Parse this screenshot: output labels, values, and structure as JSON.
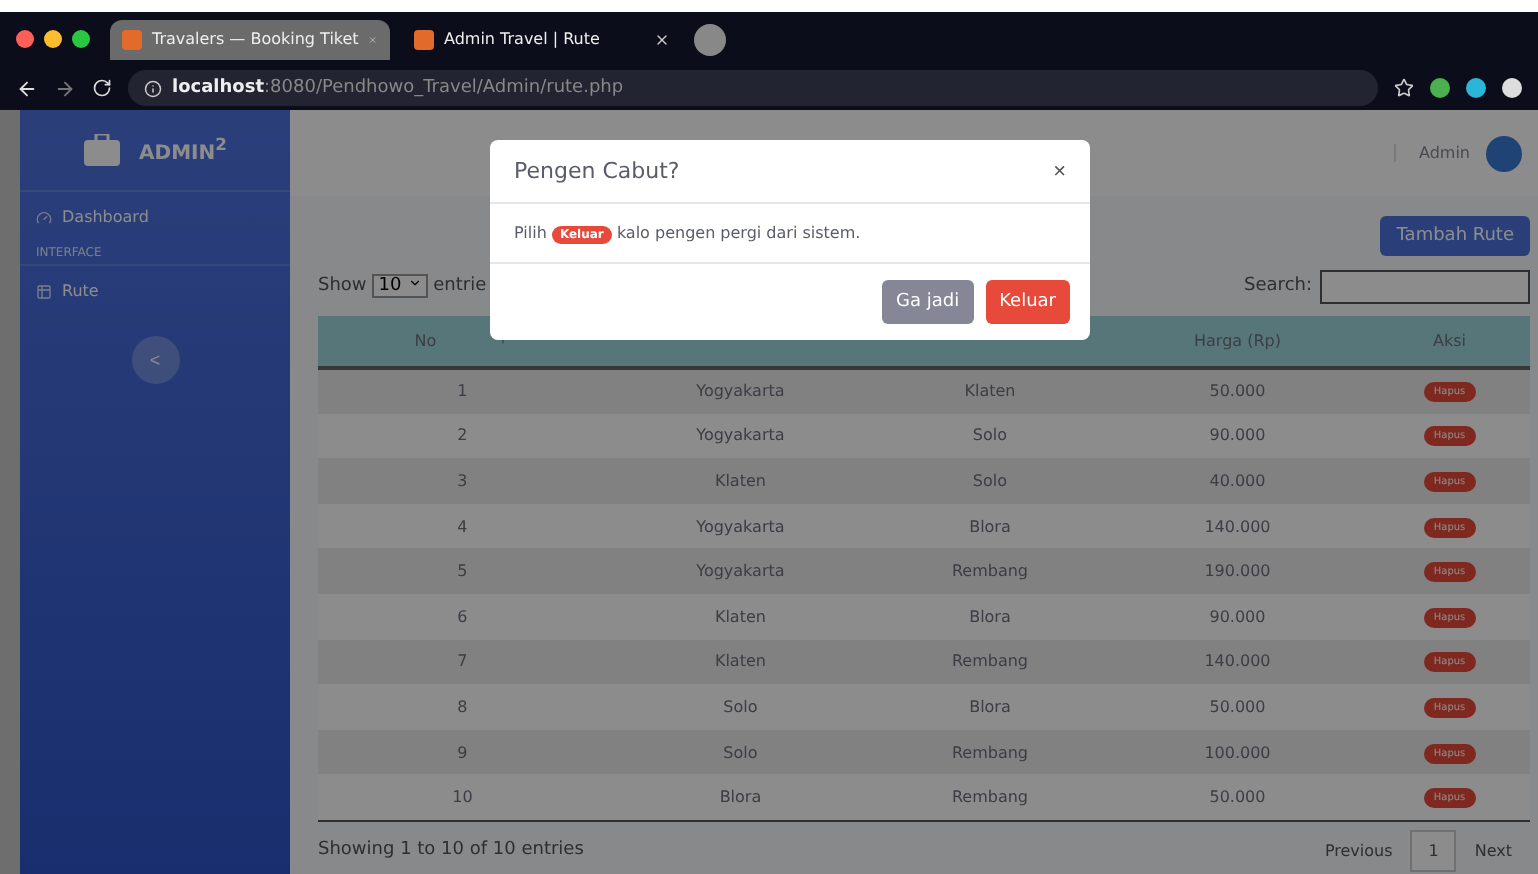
{
  "browser": {
    "tabs": [
      {
        "title": "Travalers — Booking Tiket",
        "selected": true
      },
      {
        "title": "Admin Travel | Rute",
        "selected": false
      }
    ],
    "url_host": "localhost",
    "url_path": ":8080/Pendhowo_Travel/Admin/rute.php"
  },
  "sidebar": {
    "brand": "ADMIN$^{2}$",
    "items": [
      {
        "kind": "link",
        "label": "Dashboard"
      },
      {
        "kind": "heading",
        "label": "INTERFACE"
      },
      {
        "kind": "link",
        "label": "Rute"
      }
    ],
    "toggle": "<"
  },
  "topbar": {
    "user": "Admin"
  },
  "add_button": "Tambah Rute",
  "length": {
    "show": "Show",
    "value": "10",
    "suffix": "entrie"
  },
  "search": {
    "label": "Search:"
  },
  "table": {
    "columns": [
      "No",
      "",
      "",
      "Harga (Rp)",
      "Aksi"
    ],
    "rows": [
      {
        "no": "1",
        "column_2": "Yogyakarta",
        "column_3": "Klaten",
        "harga": "50.000",
        "action": "Hapus"
      },
      {
        "no": "2",
        "column_2": "Yogyakarta",
        "column_3": "Solo",
        "harga": "90.000",
        "action": "Hapus"
      },
      {
        "no": "3",
        "column_2": "Klaten",
        "column_3": "Solo",
        "harga": "40.000",
        "action": "Hapus"
      },
      {
        "no": "4",
        "column_2": "Yogyakarta",
        "column_3": "Blora",
        "harga": "140.000",
        "action": "Hapus"
      },
      {
        "no": "5",
        "column_2": "Yogyakarta",
        "column_3": "Rembang",
        "harga": "190.000",
        "action": "Hapus"
      },
      {
        "no": "6",
        "column_2": "Klaten",
        "column_3": "Blora",
        "harga": "90.000",
        "action": "Hapus"
      },
      {
        "no": "7",
        "column_2": "Klaten",
        "column_3": "Rembang",
        "harga": "140.000",
        "action": "Hapus"
      },
      {
        "no": "8",
        "column_2": "Solo",
        "column_3": "Blora",
        "harga": "50.000",
        "action": "Hapus"
      },
      {
        "no": "9",
        "column_2": "Solo",
        "column_3": "Rembang",
        "harga": "100.000",
        "action": "Hapus"
      },
      {
        "no": "10",
        "column_2": "Blora",
        "column_3": "Rembang",
        "harga": "50.000",
        "action": "Hapus"
      }
    ]
  },
  "info": "Showing 1 to 10 of 10 entries",
  "pagination": [
    {
      "label": "Previous",
      "selected": false
    },
    {
      "label": "1",
      "selected": true
    },
    {
      "label": "Next",
      "selected": false
    }
  ],
  "modal": {
    "title": "Pengen Cabut?",
    "close": "×",
    "message_before": "Pilih",
    "badge": "Keluar",
    "message_after": "kalo pengen pergi dari sistem.",
    "buttons": [
      {
        "kind": "secondary",
        "label": "Ga jadi"
      },
      {
        "kind": "danger",
        "label": "Keluar"
      }
    ]
  }
}
